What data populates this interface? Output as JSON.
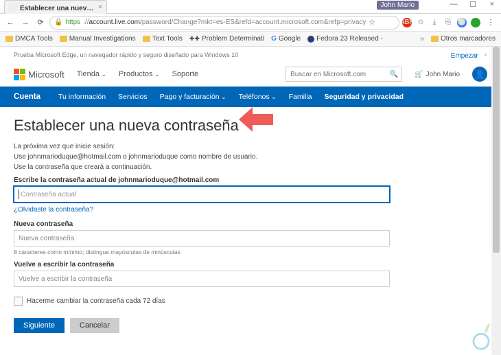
{
  "window": {
    "tab_title": "Establecer una nueva co",
    "user_chip": "John Mario"
  },
  "toolbar": {
    "url_scheme": "https",
    "url_host": "account.live.com",
    "url_rest": "/password/Change?mkt=es-ES&refd=account.microsoft.com&refp=privacy"
  },
  "bookmarks": {
    "items": [
      "DMCA Tools",
      "Manual Investigations",
      "Text Tools",
      "Problem Determinati",
      "Google",
      "Fedora 23 Released -"
    ],
    "more": "»",
    "other": "Otros marcadores"
  },
  "edgePromo": {
    "text": "Prueba Microsoft Edge, un navegador rápido y seguro diseñado para Windows 10",
    "cta": "Empezar"
  },
  "msHeader": {
    "logo": "Microsoft",
    "items": [
      "Tienda",
      "Productos",
      "Soporte"
    ],
    "search_placeholder": "Buscar en Microsoft.com",
    "user": "John Mario"
  },
  "nav": {
    "brand": "Cuenta",
    "items": [
      "Tu información",
      "Servicios",
      "Pago y facturación",
      "Teléfonos",
      "Familia",
      "Seguridad y privacidad"
    ]
  },
  "form": {
    "title": "Establecer una nueva contraseña",
    "desc1": "La próxima vez que inicie sesión:",
    "desc2": "Use johnmarioduque@hotmail.com o johnmarioduque como nombre de usuario.",
    "desc3": "Use la contraseña que creará a continuación.",
    "label_current": "Escribe la contraseña actual de johnmarioduque@hotmail.com",
    "placeholder_current": "Contraseña actual",
    "forgot": "¿Olvidaste la contraseña?",
    "label_new": "Nueva contraseña",
    "placeholder_new": "Nueva contraseña",
    "hint_new": "8 caracteres como mínimo; distingue mayúsculas de minúsculas",
    "label_confirm": "Vuelve a escribir la contraseña",
    "placeholder_confirm": "Vuelve a escribir la contraseña",
    "checkbox": "Hacerme cambiar la contraseña cada 72 días",
    "submit": "Siguiente",
    "cancel": "Cancelar"
  }
}
